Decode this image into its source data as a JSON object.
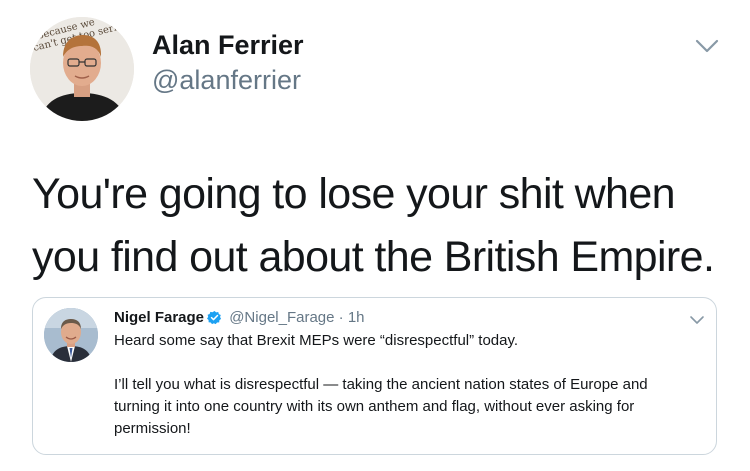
{
  "author": {
    "name": "Alan Ferrier",
    "handle": "@alanferrier",
    "avatar_text": "because we can't get too serious"
  },
  "tweet": {
    "lines": [
      "You're going to lose your shit when",
      "you find out about the British Empire."
    ]
  },
  "quoted": {
    "name": "Nigel Farage",
    "handle": "@Nigel_Farage",
    "separator": "·",
    "time": "1h",
    "paragraph1": "Heard some say that Brexit MEPs were “disrespectful” today.",
    "paragraph2_lines": [
      "I’ll tell you what is disrespectful — taking the ancient nation states of Europe and",
      "turning it into one country with its own anthem and flag, without ever asking for",
      "permission!"
    ]
  },
  "icons": {
    "menu": "chevron-down-icon",
    "verified": "verified-badge-icon"
  },
  "colors": {
    "text": "#14171a",
    "secondary": "#657786",
    "border": "#ccd6dd",
    "verified": "#1da1f2"
  }
}
